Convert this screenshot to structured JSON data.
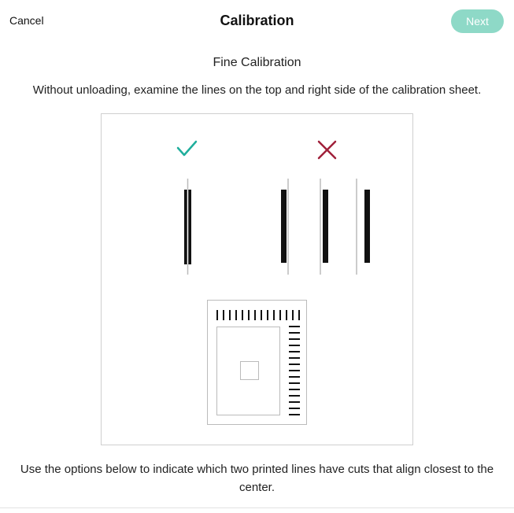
{
  "header": {
    "cancel_label": "Cancel",
    "title": "Calibration",
    "next_label": "Next"
  },
  "main": {
    "subtitle": "Fine Calibration",
    "instruction": "Without unloading, examine the lines on the top and right side of the calibration sheet.",
    "bottom_text": "Use the options below to indicate which two printed lines have cuts that align closest to the center."
  },
  "illustration": {
    "correct_icon": "checkmark-icon",
    "incorrect_icon": "x-mark-icon"
  },
  "colors": {
    "accent": "#1fae9c",
    "error": "#a0203a",
    "next_disabled_bg": "#8ed9c7"
  }
}
